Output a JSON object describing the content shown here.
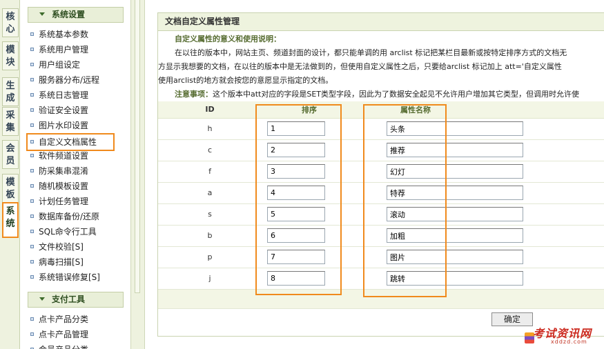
{
  "tabs": [
    {
      "label": "核心",
      "active": false
    },
    {
      "label": "模块",
      "active": false
    },
    {
      "label": "生成",
      "active": false
    },
    {
      "label": "采集",
      "active": false
    },
    {
      "label": "会员",
      "active": false
    },
    {
      "label": "模板",
      "active": false
    },
    {
      "label": "系统",
      "active": true
    }
  ],
  "sidebar": {
    "sections": [
      {
        "title": "系统设置",
        "items": [
          {
            "label": "系统基本参数"
          },
          {
            "label": "系统用户管理"
          },
          {
            "label": "用户组设定"
          },
          {
            "label": "服务器分布/远程"
          },
          {
            "label": "系统日志管理"
          },
          {
            "label": "验证安全设置"
          },
          {
            "label": "图片水印设置"
          },
          {
            "label": "自定义文档属性",
            "highlighted": true
          },
          {
            "label": "软件频道设置"
          },
          {
            "label": "防采集串混淆"
          },
          {
            "label": "随机模板设置"
          },
          {
            "label": "计划任务管理"
          },
          {
            "label": "数据库备份/还原"
          },
          {
            "label": "SQL命令行工具"
          },
          {
            "label": "文件校验[S]"
          },
          {
            "label": "病毒扫描[S]"
          },
          {
            "label": "系统错误修复[S]"
          }
        ]
      },
      {
        "title": "支付工具",
        "items": [
          {
            "label": "点卡产品分类"
          },
          {
            "label": "点卡产品管理"
          },
          {
            "label": "会员产品分类"
          }
        ]
      }
    ]
  },
  "main": {
    "title": "文档自定义属性管理",
    "desc_heading": "自定义属性的意义和使用说明：",
    "desc_line1": "在以往的版本中，网站主页、频道封面的设计，都只能单调的用 arclist 标记把某栏目最新或按特定排序方式的文档无",
    "desc_line2": "方显示我想要的文档，在以往的版本中是无法做到的，但使用自定义属性之后，只要给arclist 标记加上 att='自定义属性",
    "desc_line3": "使用arclist的地方就会按您的意愿显示指定的文档。",
    "note_label": "注意事项：",
    "note_text": "这个版本中att对应的字段是SET类型字段，因此为了数据安全起见不允许用户增加其它类型，但调用时允许使",
    "table": {
      "headers": {
        "id": "ID",
        "order": "排序",
        "name": "属性名称"
      },
      "rows": [
        {
          "id": "h",
          "order": "1",
          "name": "头条"
        },
        {
          "id": "c",
          "order": "2",
          "name": "推荐"
        },
        {
          "id": "f",
          "order": "3",
          "name": "幻灯"
        },
        {
          "id": "a",
          "order": "4",
          "name": "特荐"
        },
        {
          "id": "s",
          "order": "5",
          "name": "滚动"
        },
        {
          "id": "b",
          "order": "6",
          "name": "加粗"
        },
        {
          "id": "p",
          "order": "7",
          "name": "图片"
        },
        {
          "id": "j",
          "order": "8",
          "name": "跳转"
        }
      ]
    },
    "submit_label": "确定"
  },
  "watermark": {
    "text": "考试资讯网",
    "sub": "xddzd.com"
  },
  "colors": {
    "highlight": "#f08a1c",
    "accent_green": "#556b2f",
    "header_bg": "#eef3de"
  }
}
